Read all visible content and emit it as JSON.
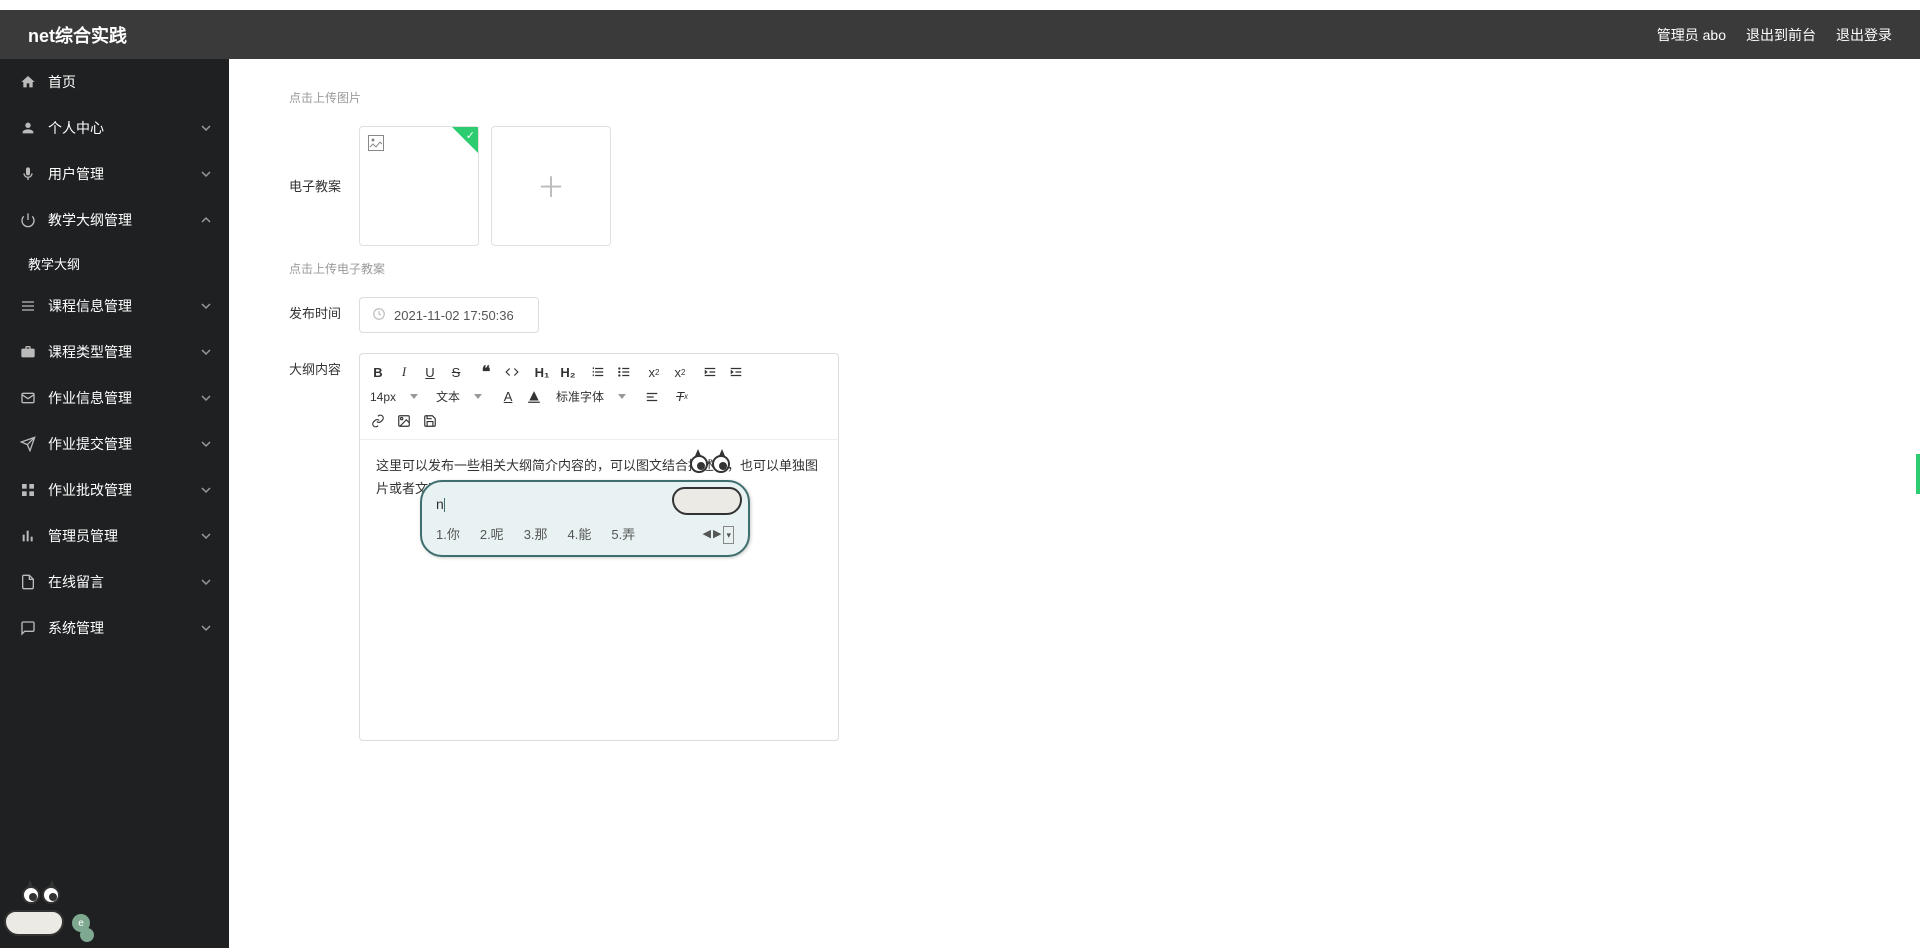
{
  "header": {
    "title": "net综合实践",
    "user_label": "管理员 abo",
    "to_front": "退出到前台",
    "logout": "退出登录"
  },
  "sidebar": {
    "home": "首页",
    "items": [
      {
        "label": "个人中心",
        "icon": "user"
      },
      {
        "label": "用户管理",
        "icon": "mic"
      },
      {
        "label": "教学大纲管理",
        "icon": "power",
        "expanded": true
      },
      {
        "label": "课程信息管理",
        "icon": "list"
      },
      {
        "label": "课程类型管理",
        "icon": "briefcase"
      },
      {
        "label": "作业信息管理",
        "icon": "mail"
      },
      {
        "label": "作业提交管理",
        "icon": "send"
      },
      {
        "label": "作业批改管理",
        "icon": "grid"
      },
      {
        "label": "管理员管理",
        "icon": "bars"
      },
      {
        "label": "在线留言",
        "icon": "doc"
      },
      {
        "label": "系统管理",
        "icon": "chat"
      }
    ],
    "sub_item": "教学大纲"
  },
  "form": {
    "upload_image_hint": "点击上传图片",
    "lesson_plan_label": "电子教案",
    "upload_plan_hint": "点击上传电子教案",
    "publish_time_label": "发布时间",
    "publish_time_value": "2021-11-02 17:50:36",
    "outline_label": "大纲内容",
    "editor_text": "这里可以发布一些相关大纲简介内容的，可以图文结合描述的，也可以单独图片或者文字描述的，这里的所有n"
  },
  "editor_toolbar": {
    "font_size": "14px",
    "para_format": "文本",
    "font_family": "标准字体",
    "bold": "B",
    "italic": "I",
    "underline": "U",
    "strike": "S",
    "h1": "H₁",
    "h2": "H₂"
  },
  "ime": {
    "input_text": "n",
    "candidates": [
      "1.你",
      "2.呢",
      "3.那",
      "4.能",
      "5.弄"
    ],
    "nav_left": "◀",
    "nav_right": "▶"
  }
}
